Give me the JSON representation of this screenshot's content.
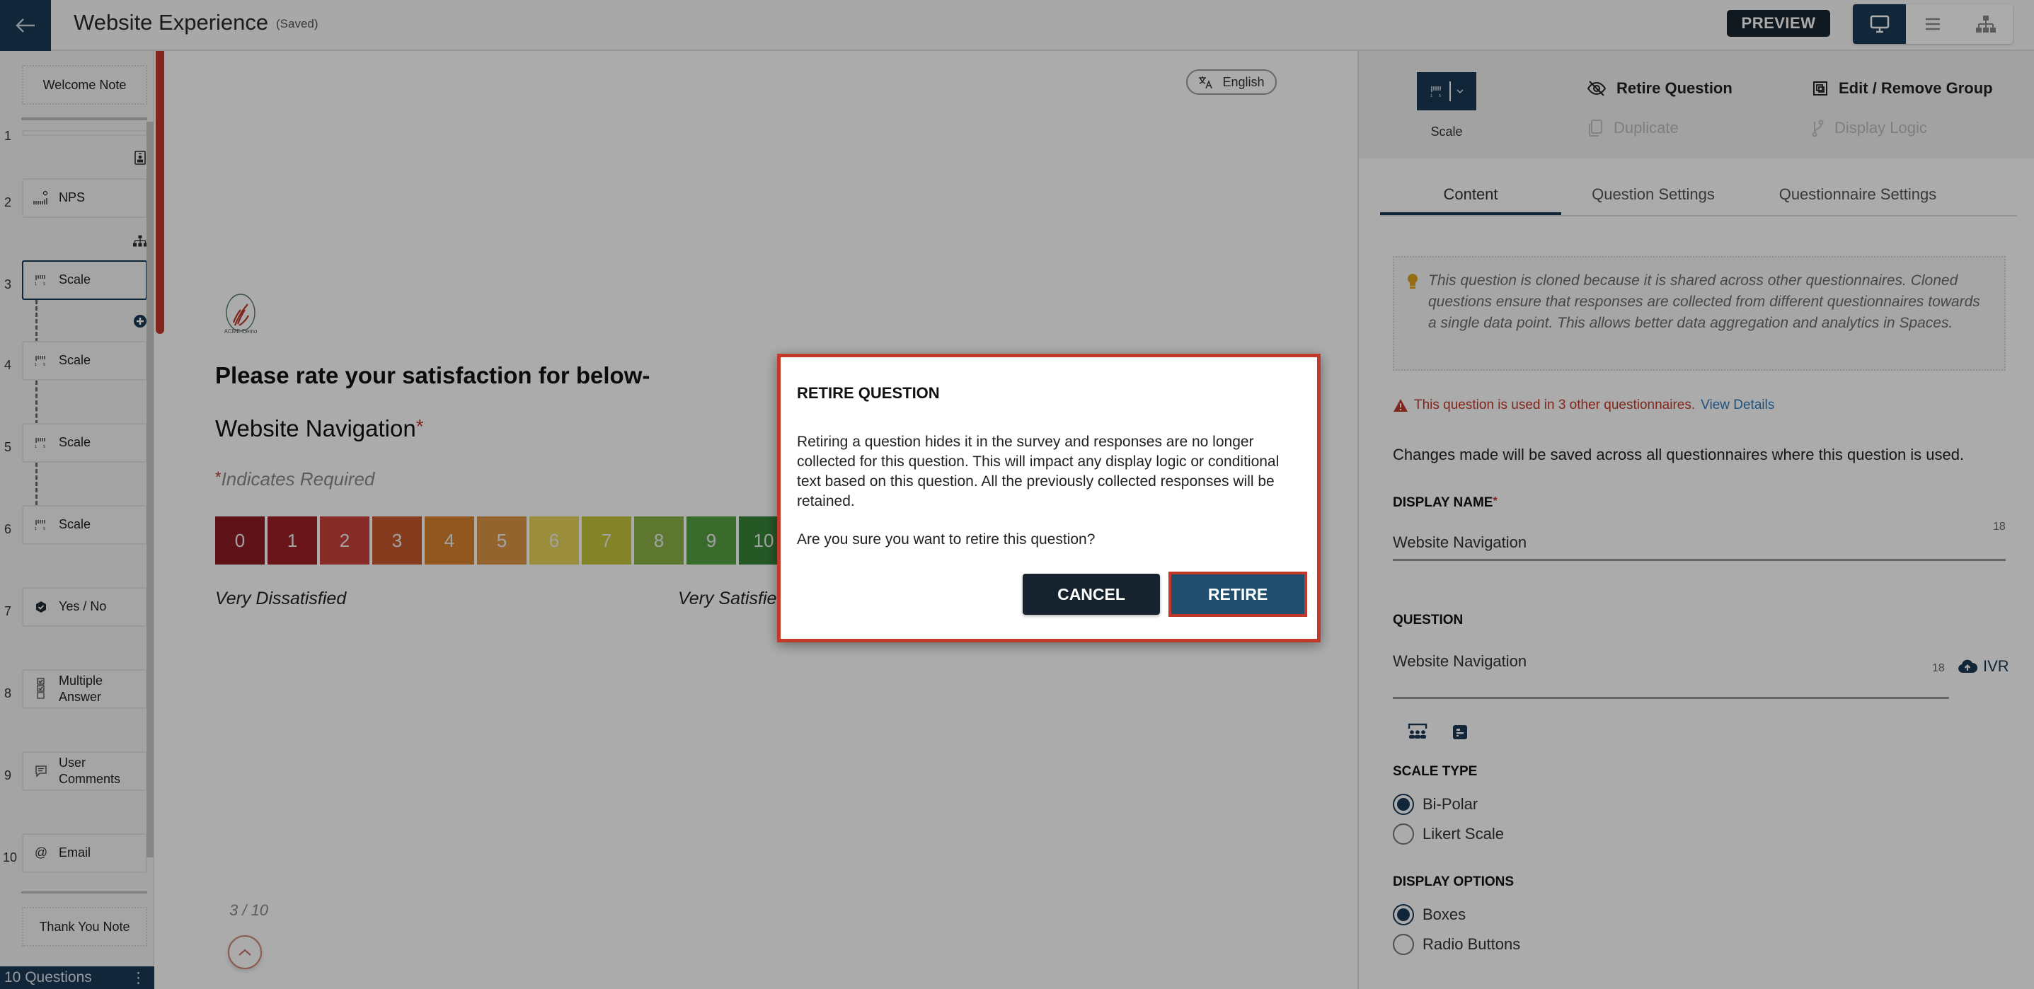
{
  "header": {
    "title": "Website Experience",
    "status": "(Saved)",
    "preview_label": "PREVIEW",
    "view_modes": [
      {
        "icon": "desktop-icon",
        "active": true
      },
      {
        "icon": "list-icon",
        "active": false
      },
      {
        "icon": "hierarchy-icon",
        "active": false
      }
    ]
  },
  "rail": {
    "welcome_note": "Welcome Note",
    "thank_you_note": "Thank You Note",
    "questions": [
      {
        "num": "1",
        "label": "",
        "icon": "blank"
      },
      {
        "num": "2",
        "label": "NPS",
        "icon": "nps-icon"
      },
      {
        "num": "3",
        "label": "Scale",
        "icon": "scale-icon",
        "selected": true
      },
      {
        "num": "4",
        "label": "Scale",
        "icon": "scale-icon"
      },
      {
        "num": "5",
        "label": "Scale",
        "icon": "scale-icon"
      },
      {
        "num": "6",
        "label": "Scale",
        "icon": "scale-icon"
      },
      {
        "num": "7",
        "label": "Yes / No",
        "icon": "check-badge-icon"
      },
      {
        "num": "8",
        "label": "Multiple Answer",
        "icon": "checklist-icon"
      },
      {
        "num": "9",
        "label": "User Comments",
        "icon": "comment-icon"
      },
      {
        "num": "10",
        "label": "Email",
        "icon": "at-icon"
      }
    ],
    "footer_label": "10 Questions",
    "footer_menu": "⋮"
  },
  "preview": {
    "language": "English",
    "logo_text": "ACME Demo",
    "survey_title": "Please rate your satisfaction for below-",
    "question": "Website Navigation",
    "required_marker": "*",
    "required_note": "Indicates Required",
    "scale": {
      "values": [
        "0",
        "1",
        "2",
        "3",
        "4",
        "5",
        "6",
        "7",
        "8",
        "9",
        "10"
      ],
      "colors": [
        "#8e1c24",
        "#9f2028",
        "#c8403a",
        "#c75a2e",
        "#d9822f",
        "#dc9643",
        "#e6d45a",
        "#c4c53d",
        "#8bb24a",
        "#55a044",
        "#378336"
      ],
      "low_label": "Very Dissatisfied",
      "high_label": "Very Satisfied"
    },
    "pager": "3 / 10"
  },
  "panel": {
    "question_type": "Scale",
    "actions": {
      "retire": "Retire Question",
      "edit_group": "Edit / Remove Group",
      "duplicate": "Duplicate",
      "display_logic": "Display Logic"
    },
    "tabs": [
      "Content",
      "Question Settings",
      "Questionnaire Settings"
    ],
    "active_tab": "Content",
    "info_text": "This question is cloned because it is shared across other questionnaires. Cloned questions ensure that responses are collected from different questionnaires towards a single data point. This allows better data aggregation and analytics in Spaces.",
    "warning_text": "This question is used in 3 other questionnaires.",
    "warning_link": "View Details",
    "changes_note": "Changes made will be saved across all questionnaires where this question is used.",
    "display_name_label": "DISPLAY NAME",
    "display_name_value": "Website Navigation",
    "display_name_count": "18",
    "question_label": "QUESTION",
    "question_value": "Website Navigation",
    "question_count": "18",
    "ivr_label": "IVR",
    "scale_type_label": "SCALE TYPE",
    "scale_type_options": [
      {
        "label": "Bi-Polar",
        "selected": true
      },
      {
        "label": "Likert Scale",
        "selected": false
      }
    ],
    "display_options_label": "DISPLAY OPTIONS",
    "display_options": [
      {
        "label": "Boxes",
        "selected": true
      },
      {
        "label": "Radio Buttons",
        "selected": false
      }
    ]
  },
  "modal": {
    "title": "RETIRE QUESTION",
    "body": "Retiring a question hides it in the survey and responses are no longer collected for this question. This will impact any display logic or conditional text based on this question. All the previously collected responses will be retained.",
    "confirm_question": "Are you sure you want to retire this question?",
    "cancel_label": "CANCEL",
    "retire_label": "RETIRE"
  },
  "colors": {
    "brand": "#1b3a57",
    "accent_red": "#c0392b",
    "link": "#2d7bbd"
  }
}
